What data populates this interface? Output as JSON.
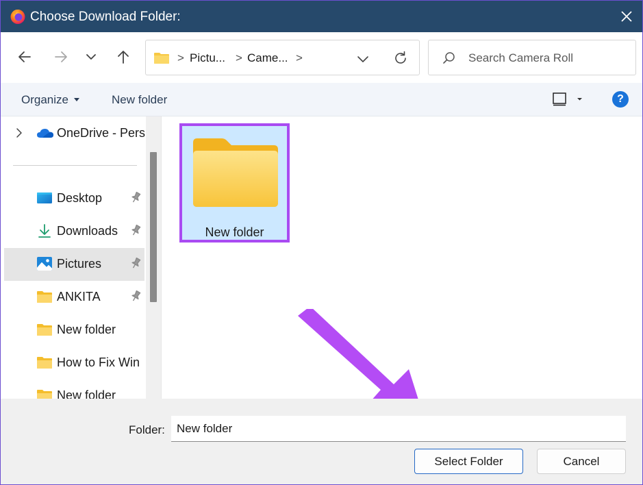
{
  "titlebar": {
    "title": "Choose Download Folder:",
    "app_icon": "firefox-icon",
    "close_icon": "close-icon"
  },
  "nav": {
    "back_icon": "arrow-left-icon",
    "forward_icon": "arrow-right-icon",
    "recent_icon": "chevron-down-icon",
    "up_icon": "arrow-up-icon"
  },
  "address": {
    "crumbs": [
      "Pictu...",
      "Came..."
    ],
    "separator": ">",
    "refresh_icon": "refresh-icon"
  },
  "search": {
    "placeholder": "Search Camera Roll",
    "value": ""
  },
  "commands": {
    "organize": "Organize",
    "new_folder": "New folder",
    "help": "?"
  },
  "navpane": {
    "onedrive": "OneDrive - Pers",
    "items": [
      {
        "label": "Desktop",
        "icon": "desktop-icon",
        "pinned": true
      },
      {
        "label": "Downloads",
        "icon": "download-icon",
        "pinned": true
      },
      {
        "label": "Pictures",
        "icon": "pictures-icon",
        "pinned": true,
        "selected": true
      },
      {
        "label": "ANKITA",
        "icon": "folder-icon",
        "pinned": true
      },
      {
        "label": "New folder",
        "icon": "folder-icon",
        "pinned": false
      },
      {
        "label": "How to Fix Win",
        "icon": "folder-icon",
        "pinned": false
      },
      {
        "label": "New folder",
        "icon": "folder-icon",
        "pinned": false
      }
    ]
  },
  "content": {
    "items": [
      {
        "label": "New folder",
        "selected": true
      }
    ]
  },
  "footer": {
    "folder_label": "Folder:",
    "folder_value": "New folder",
    "select_button": "Select Folder",
    "cancel_button": "Cancel"
  },
  "colors": {
    "titlebar": "#26496b",
    "selection": "#cce8ff",
    "highlight": "#a94bf2",
    "arrow": "#b44cf5",
    "accent": "#1a73d9"
  }
}
